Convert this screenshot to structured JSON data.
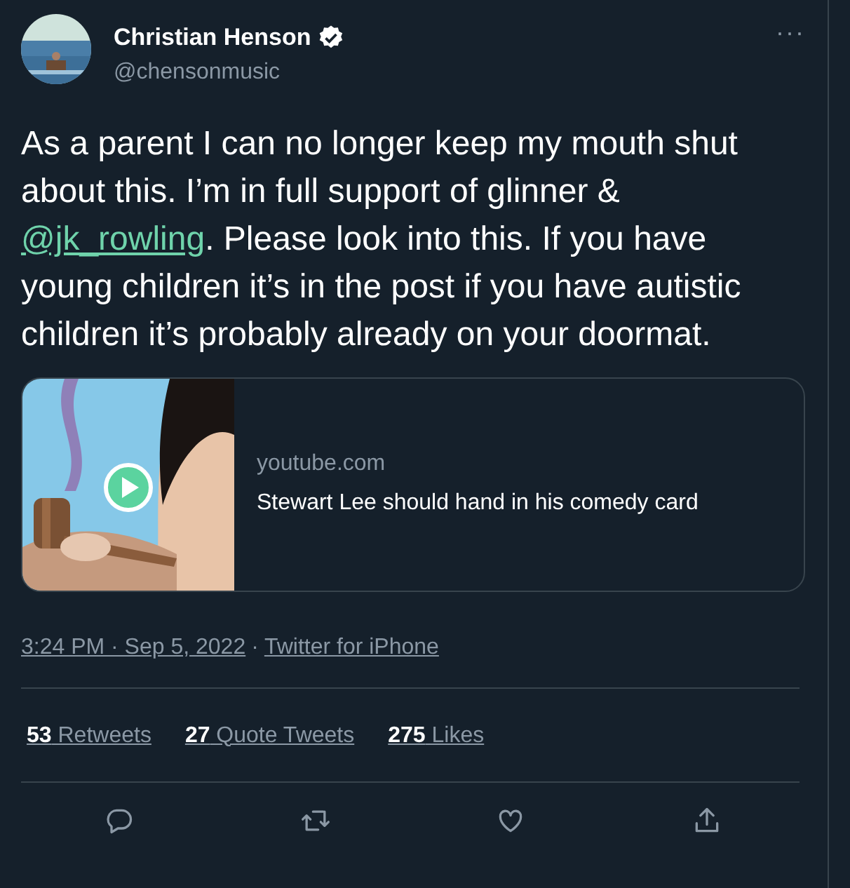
{
  "author": {
    "name": "Christian Henson",
    "verified": true,
    "handle": "@chensonmusic"
  },
  "more": "···",
  "body": [
    {
      "kind": "text",
      "text": "As a parent I can no longer keep my mouth shut about this. I’m in full support of glinner & "
    },
    {
      "kind": "mention",
      "text": "@jk_rowling"
    },
    {
      "kind": "text",
      "text": ". Please look into this. If you have young children it’s in the post if you have autistic children it’s probably already on your doormat."
    }
  ],
  "card": {
    "kind": "picture",
    "video": true,
    "domain": "youtube.com",
    "title": "Stewart Lee should hand in his comedy card"
  },
  "meta": {
    "time": "3:24 PM · Sep 5, 2022",
    "separator": "·",
    "source": "Twitter for iPhone"
  },
  "stats": [
    {
      "count": "53",
      "label": " Retweets"
    },
    {
      "count": "27",
      "label": " Quote Tweets"
    },
    {
      "count": "275",
      "label": " Likes"
    }
  ],
  "actions": [
    {
      "kind": "reply"
    },
    {
      "kind": "retweet"
    },
    {
      "kind": "like"
    },
    {
      "kind": "share"
    }
  ]
}
